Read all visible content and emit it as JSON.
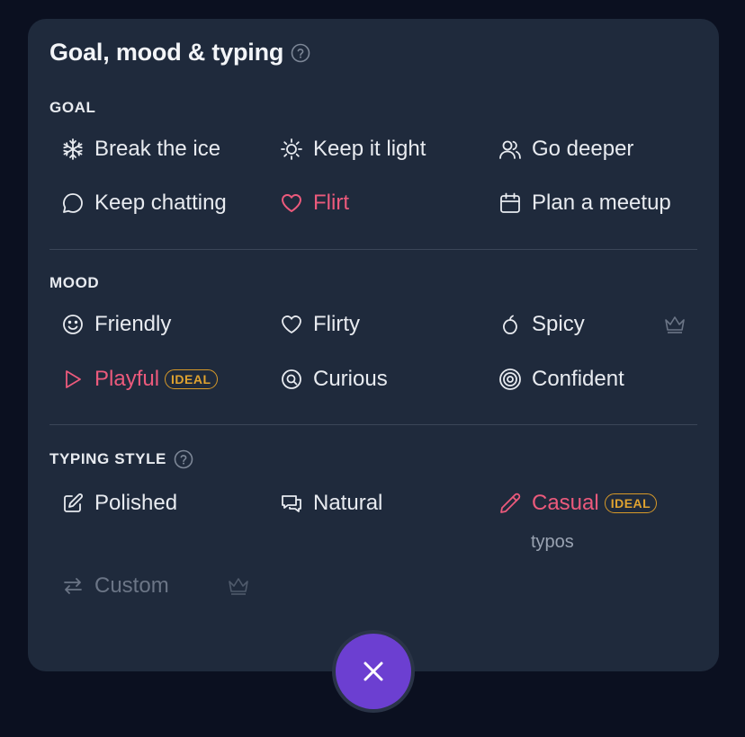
{
  "title": "Goal, mood & typing",
  "help_icon": "question-circle-icon",
  "goal": {
    "label": "GOAL",
    "options": [
      {
        "label": "Break the ice",
        "icon": "snowflake-icon",
        "selected": false
      },
      {
        "label": "Keep it light",
        "icon": "sun-icon",
        "selected": false
      },
      {
        "label": "Go deeper",
        "icon": "users-icon",
        "selected": false
      },
      {
        "label": "Keep chatting",
        "icon": "chat-bubble-icon",
        "selected": false
      },
      {
        "label": "Flirt",
        "icon": "heart-icon",
        "selected": true
      },
      {
        "label": "Plan a meetup",
        "icon": "calendar-icon",
        "selected": false
      }
    ]
  },
  "mood": {
    "label": "MOOD",
    "options": [
      {
        "label": "Friendly",
        "icon": "smile-icon",
        "selected": false
      },
      {
        "label": "Flirty",
        "icon": "heart-outline-icon",
        "selected": false
      },
      {
        "label": "Spicy",
        "icon": "pepper-icon",
        "selected": false,
        "premium": true
      },
      {
        "label": "Playful",
        "icon": "play-icon",
        "selected": true,
        "badge": "IDEAL"
      },
      {
        "label": "Curious",
        "icon": "at-search-icon",
        "selected": false
      },
      {
        "label": "Confident",
        "icon": "target-icon",
        "selected": false
      }
    ]
  },
  "typing": {
    "label": "TYPING STYLE",
    "options": [
      {
        "label": "Polished",
        "icon": "edit-icon",
        "selected": false
      },
      {
        "label": "Natural",
        "icon": "chat-bubbles-icon",
        "selected": false
      },
      {
        "label": "Casual",
        "icon": "pencil-icon",
        "selected": true,
        "badge": "IDEAL",
        "sub": "typos"
      },
      {
        "label": "Custom",
        "icon": "swap-icon",
        "selected": false,
        "disabled": true,
        "premium": true
      }
    ]
  },
  "colors": {
    "accent": "#ec5a7c",
    "badge": "#e0a330",
    "fab": "#6c3fd1",
    "panel": "#1f2a3c"
  },
  "close_icon": "close-icon"
}
